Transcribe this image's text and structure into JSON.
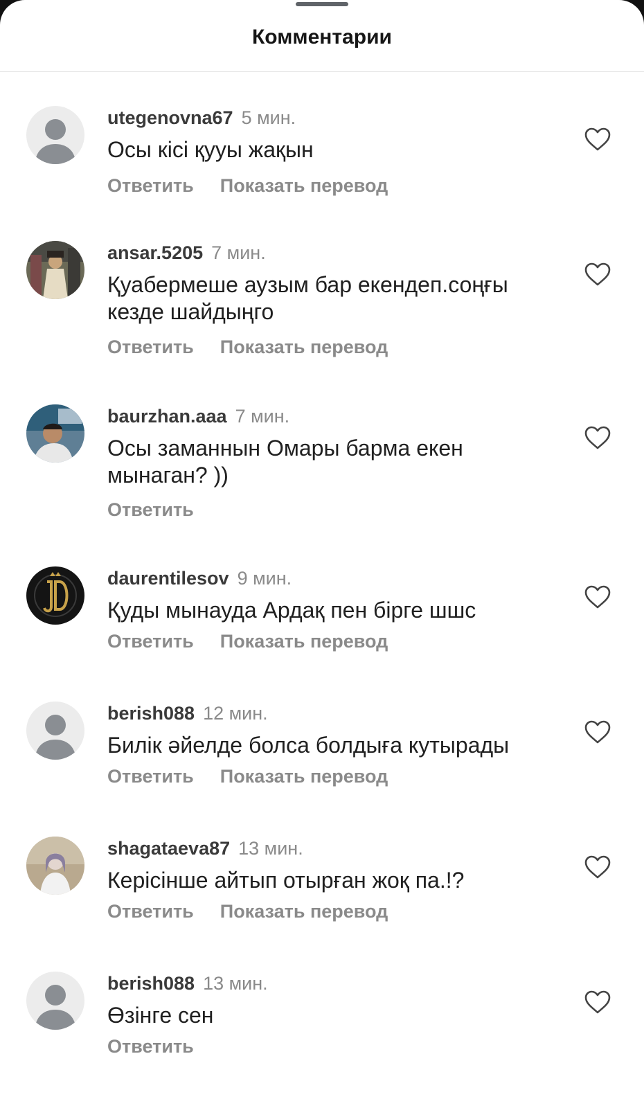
{
  "header": {
    "title": "Комментарии"
  },
  "comments": [
    {
      "username": "utegenovna67",
      "time": "5 мин.",
      "text": "Осы кісі қууы жақын",
      "avatar_type": "placeholder",
      "reply_label": "Ответить",
      "translate_label": "Показать перевод"
    },
    {
      "username": "ansar.5205",
      "time": "7 мин.",
      "text": "Қуабермеше аузым бар екендеп.соңғы кезде шайдыңго",
      "avatar_type": "photo",
      "reply_label": "Ответить",
      "translate_label": "Показать перевод"
    },
    {
      "username": "baurzhan.aaa",
      "time": "7 мин.",
      "text": "Осы заманнын Омары барма екен мынаган? ))",
      "avatar_type": "photo",
      "reply_label": "Ответить"
    },
    {
      "username": "daurentilesov",
      "time": "9 мин.",
      "text": "Қуды мынауда Ардақ пен бірге шшс",
      "avatar_type": "logo",
      "reply_label": "Ответить",
      "translate_label": "Показать перевод"
    },
    {
      "username": "berish088",
      "time": "12 мин.",
      "text": "Билік әйелде болса болдыға кутырады",
      "avatar_type": "placeholder",
      "reply_label": "Ответить",
      "translate_label": "Показать перевод"
    },
    {
      "username": "shagataeva87",
      "time": "13 мин.",
      "text": "Керісінше айтып отырған жоқ па.!?",
      "avatar_type": "photo",
      "reply_label": "Ответить",
      "translate_label": "Показать перевод"
    },
    {
      "username": "berish088",
      "time": "13 мин.",
      "text": "Өзінге сен",
      "avatar_type": "placeholder",
      "reply_label": "Ответить"
    }
  ],
  "icons": {
    "like": "heart-outline-icon",
    "avatar_placeholder": "user-silhouette-icon"
  },
  "colors": {
    "text": "#202020",
    "muted": "#8a8a8a",
    "username": "#3a3a3a",
    "avatar_bg": "#ececec",
    "avatar_fg": "#8a8e93"
  }
}
